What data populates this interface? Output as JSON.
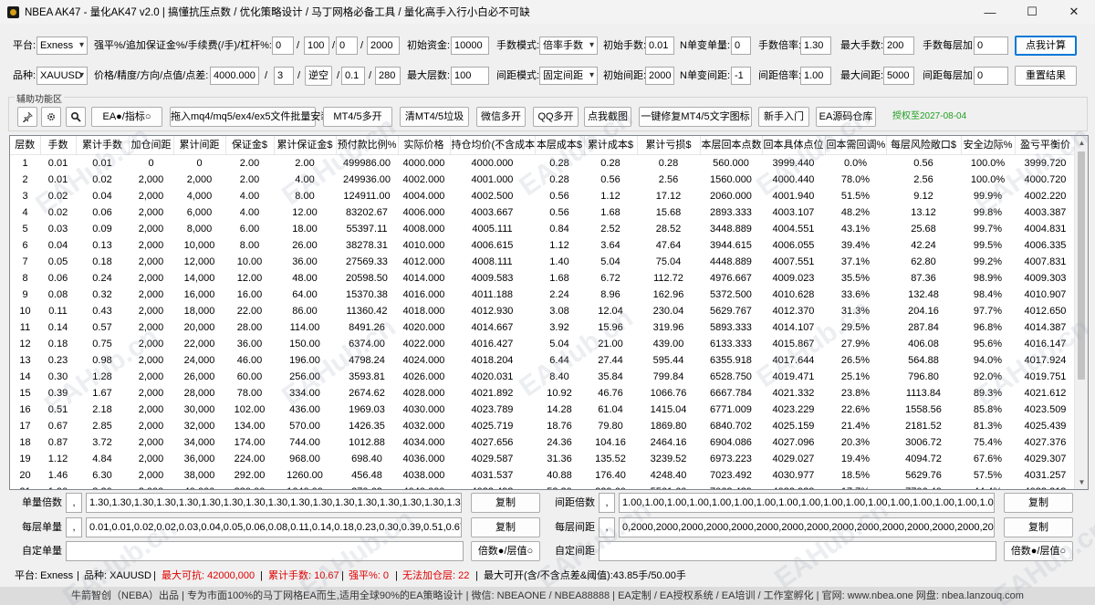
{
  "window": {
    "title": "NBEA AK47 - 量化AK47 v2.0 | 搞懂抗压点数 / 优化策略设计 / 马丁网格必备工具 / 量化高手入行小白必不可缺",
    "minimize": "—",
    "maximize": "☐",
    "close": "✕"
  },
  "row1": {
    "platform_label": "平台:",
    "platform_value": "Exness",
    "params_label": "强平%/追加保证金%/手续费(/手)/杠杆%:",
    "p1": "0",
    "p2": "100",
    "p3": "0",
    "p4": "2000",
    "initial_capital_label": "初始资金:",
    "initial_capital": "10000",
    "lot_mode_label": "手数模式:",
    "lot_mode": "倍率手数",
    "initial_lot_label": "初始手数:",
    "initial_lot": "0.01",
    "n_lot_label": "N单变单量:",
    "n_lot": "0",
    "lot_mult_label": "手数倍率:",
    "lot_mult": "1.30",
    "max_lot_label": "最大手数:",
    "max_lot": "200",
    "lot_add_label": "手数每层加:",
    "lot_add": "0",
    "calc_button": "点我计算"
  },
  "row2": {
    "symbol_label": "品种:",
    "symbol_value": "XAUUSD",
    "price_label": "价格/精度/方向/点值/点差:",
    "price": "4000.000",
    "precision": "3",
    "direction": "逆空",
    "point_value": "0.1",
    "spread": "280",
    "max_layers_label": "最大层数:",
    "max_layers": "100",
    "spacing_mode_label": "间距模式:",
    "spacing_mode": "固定间距",
    "initial_spacing_label": "初始间距:",
    "initial_spacing": "2000",
    "n_spacing_label": "N单变间距:",
    "n_spacing": "-1",
    "spacing_mult_label": "间距倍率:",
    "spacing_mult": "1.00",
    "max_spacing_label": "最大间距:",
    "max_spacing": "5000",
    "spacing_add_label": "间距每层加:",
    "spacing_add": "0",
    "reset_button": "重置结果"
  },
  "tools": {
    "group_label": "辅助功能区",
    "ea_indicator": "EA●/指标○",
    "drag_install": "拖入mq4/mq5/ex4/ex5文件批量安装",
    "mt4_multi": "MT4/5多开",
    "clean_junk": "清MT4/5垃圾",
    "wechat_multi": "微信多开",
    "qq_multi": "QQ多开",
    "screenshot": "点我截图",
    "fix_text": "一键修复MT4/5文字图标",
    "beginner": "新手入门",
    "ea_repo": "EA源码仓库",
    "auth_until": "授权至2027-08-04"
  },
  "table": {
    "headers": [
      "层数",
      "手数",
      "累计手数",
      "加仓间距",
      "累计间距",
      "保证金$",
      "累计保证金$",
      "预付款比例%",
      "实际价格",
      "持仓均价(不含成本)",
      "本层成本$",
      "累计成本$",
      "累计亏损$",
      "本层回本点数",
      "回本具体点位",
      "回本需回调%",
      "每层风险敞口$",
      "安全边际%",
      "盈亏平衡价"
    ],
    "rows": [
      [
        "1",
        "0.01",
        "0.01",
        "0",
        "0",
        "2.00",
        "2.00",
        "499986.00",
        "4000.000",
        "4000.000",
        "0.28",
        "0.28",
        "0.28",
        "560.000",
        "3999.440",
        "0.0%",
        "0.56",
        "100.0%",
        "3999.720"
      ],
      [
        "2",
        "0.01",
        "0.02",
        "2,000",
        "2,000",
        "2.00",
        "4.00",
        "249936.00",
        "4002.000",
        "4001.000",
        "0.28",
        "0.56",
        "2.56",
        "1560.000",
        "4000.440",
        "78.0%",
        "2.56",
        "100.0%",
        "4000.720"
      ],
      [
        "3",
        "0.02",
        "0.04",
        "2,000",
        "4,000",
        "4.00",
        "8.00",
        "124911.00",
        "4004.000",
        "4002.500",
        "0.56",
        "1.12",
        "17.12",
        "2060.000",
        "4001.940",
        "51.5%",
        "9.12",
        "99.9%",
        "4002.220"
      ],
      [
        "4",
        "0.02",
        "0.06",
        "2,000",
        "6,000",
        "4.00",
        "12.00",
        "83202.67",
        "4006.000",
        "4003.667",
        "0.56",
        "1.68",
        "15.68",
        "2893.333",
        "4003.107",
        "48.2%",
        "13.12",
        "99.8%",
        "4003.387"
      ],
      [
        "5",
        "0.03",
        "0.09",
        "2,000",
        "8,000",
        "6.00",
        "18.00",
        "55397.11",
        "4008.000",
        "4005.111",
        "0.84",
        "2.52",
        "28.52",
        "3448.889",
        "4004.551",
        "43.1%",
        "25.68",
        "99.7%",
        "4004.831"
      ],
      [
        "6",
        "0.04",
        "0.13",
        "2,000",
        "10,000",
        "8.00",
        "26.00",
        "38278.31",
        "4010.000",
        "4006.615",
        "1.12",
        "3.64",
        "47.64",
        "3944.615",
        "4006.055",
        "39.4%",
        "42.24",
        "99.5%",
        "4006.335"
      ],
      [
        "7",
        "0.05",
        "0.18",
        "2,000",
        "12,000",
        "10.00",
        "36.00",
        "27569.33",
        "4012.000",
        "4008.111",
        "1.40",
        "5.04",
        "75.04",
        "4448.889",
        "4007.551",
        "37.1%",
        "62.80",
        "99.2%",
        "4007.831"
      ],
      [
        "8",
        "0.06",
        "0.24",
        "2,000",
        "14,000",
        "12.00",
        "48.00",
        "20598.50",
        "4014.000",
        "4009.583",
        "1.68",
        "6.72",
        "112.72",
        "4976.667",
        "4009.023",
        "35.5%",
        "87.36",
        "98.9%",
        "4009.303"
      ],
      [
        "9",
        "0.08",
        "0.32",
        "2,000",
        "16,000",
        "16.00",
        "64.00",
        "15370.38",
        "4016.000",
        "4011.188",
        "2.24",
        "8.96",
        "162.96",
        "5372.500",
        "4010.628",
        "33.6%",
        "132.48",
        "98.4%",
        "4010.907"
      ],
      [
        "10",
        "0.11",
        "0.43",
        "2,000",
        "18,000",
        "22.00",
        "86.00",
        "11360.42",
        "4018.000",
        "4012.930",
        "3.08",
        "12.04",
        "230.04",
        "5629.767",
        "4012.370",
        "31.3%",
        "204.16",
        "97.7%",
        "4012.650"
      ],
      [
        "11",
        "0.14",
        "0.57",
        "2,000",
        "20,000",
        "28.00",
        "114.00",
        "8491.26",
        "4020.000",
        "4014.667",
        "3.92",
        "15.96",
        "319.96",
        "5893.333",
        "4014.107",
        "29.5%",
        "287.84",
        "96.8%",
        "4014.387"
      ],
      [
        "12",
        "0.18",
        "0.75",
        "2,000",
        "22,000",
        "36.00",
        "150.00",
        "6374.00",
        "4022.000",
        "4016.427",
        "5.04",
        "21.00",
        "439.00",
        "6133.333",
        "4015.867",
        "27.9%",
        "406.08",
        "95.6%",
        "4016.147"
      ],
      [
        "13",
        "0.23",
        "0.98",
        "2,000",
        "24,000",
        "46.00",
        "196.00",
        "4798.24",
        "4024.000",
        "4018.204",
        "6.44",
        "27.44",
        "595.44",
        "6355.918",
        "4017.644",
        "26.5%",
        "564.88",
        "94.0%",
        "4017.924"
      ],
      [
        "14",
        "0.30",
        "1.28",
        "2,000",
        "26,000",
        "60.00",
        "256.00",
        "3593.81",
        "4026.000",
        "4020.031",
        "8.40",
        "35.84",
        "799.84",
        "6528.750",
        "4019.471",
        "25.1%",
        "796.80",
        "92.0%",
        "4019.751"
      ],
      [
        "15",
        "0.39",
        "1.67",
        "2,000",
        "28,000",
        "78.00",
        "334.00",
        "2674.62",
        "4028.000",
        "4021.892",
        "10.92",
        "46.76",
        "1066.76",
        "6667.784",
        "4021.332",
        "23.8%",
        "1113.84",
        "89.3%",
        "4021.612"
      ],
      [
        "16",
        "0.51",
        "2.18",
        "2,000",
        "30,000",
        "102.00",
        "436.00",
        "1969.03",
        "4030.000",
        "4023.789",
        "14.28",
        "61.04",
        "1415.04",
        "6771.009",
        "4023.229",
        "22.6%",
        "1558.56",
        "85.8%",
        "4023.509"
      ],
      [
        "17",
        "0.67",
        "2.85",
        "2,000",
        "32,000",
        "134.00",
        "570.00",
        "1426.35",
        "4032.000",
        "4025.719",
        "18.76",
        "79.80",
        "1869.80",
        "6840.702",
        "4025.159",
        "21.4%",
        "2181.52",
        "81.3%",
        "4025.439"
      ],
      [
        "18",
        "0.87",
        "3.72",
        "2,000",
        "34,000",
        "174.00",
        "744.00",
        "1012.88",
        "4034.000",
        "4027.656",
        "24.36",
        "104.16",
        "2464.16",
        "6904.086",
        "4027.096",
        "20.3%",
        "3006.72",
        "75.4%",
        "4027.376"
      ],
      [
        "19",
        "1.12",
        "4.84",
        "2,000",
        "36,000",
        "224.00",
        "968.00",
        "698.40",
        "4036.000",
        "4029.587",
        "31.36",
        "135.52",
        "3239.52",
        "6973.223",
        "4029.027",
        "19.4%",
        "4094.72",
        "67.6%",
        "4029.307"
      ],
      [
        "20",
        "1.46",
        "6.30",
        "2,000",
        "38,000",
        "292.00",
        "1260.00",
        "456.48",
        "4038.000",
        "4031.537",
        "40.88",
        "176.40",
        "4248.40",
        "7023.492",
        "4030.977",
        "18.5%",
        "5629.76",
        "57.5%",
        "4031.257"
      ],
      [
        "21",
        "1.90",
        "8.20",
        "2,000",
        "40,000",
        "380.00",
        "1640.00",
        "270.63",
        "4040.000",
        "4033.498",
        "53.20",
        "229.60",
        "5561.60",
        "7062.439",
        "4032.938",
        "17.7%",
        "7706.40",
        "44.4%",
        "4033.218"
      ],
      [
        "22",
        "2.47",
        "10.67",
        "2,000",
        "42,000",
        "494.00",
        "2134.00",
        "127.89",
        "4042.000",
        "4035.466",
        "69.16",
        "298.76",
        "7270.76",
        "7094.208",
        "4034.906",
        "16.9%",
        "10512.32",
        "27.3%",
        "4035.186"
      ]
    ]
  },
  "bottom": {
    "lot_mult_label": "单量倍数",
    "lot_mult_sep": ",",
    "lot_mult_seq": "1.30,1.30,1.30,1.30,1.30,1.30,1.30,1.30,1.30,1.30,1.30,1.30,1.30,1.30,1.30,1.30,1.30",
    "copy1": "复制",
    "spacing_mult_label": "间距倍数",
    "spacing_mult_sep": ",",
    "spacing_mult_seq": "1.00,1.00,1.00,1.00,1.00,1.00,1.00,1.00,1.00,1.00,1.00,1.00,1.00,1.00,1.00,1.00,1.00,1.00,1.00",
    "copy2": "复制",
    "layer_lot_label": "每层单量",
    "layer_lot_sep": ",",
    "layer_lot_seq": "0.01,0.01,0.02,0.02,0.03,0.04,0.05,0.06,0.08,0.11,0.14,0.18,0.23,0.30,0.39,0.51,0.67,0",
    "copy3": "复制",
    "layer_spacing_label": "每层间距",
    "layer_spacing_sep": ",",
    "layer_spacing_seq": "0,2000,2000,2000,2000,2000,2000,2000,2000,2000,2000,2000,2000,2000,2000,2000,2000,20",
    "copy4": "复制",
    "custom_lot_label": "自定单量",
    "custom_lot_value": "",
    "mult_layer1": "倍数●/层值○",
    "custom_spacing_label": "自定间距",
    "custom_spacing_value": "",
    "mult_layer2": "倍数●/层值○"
  },
  "status": {
    "platform": "平台: Exness",
    "symbol": "品种: XAUUSD",
    "max_resist": "最大可抗: 42000,000",
    "cum_lot": "累计手数: 10.67",
    "liq": "强平%: 0",
    "no_add": "无法加仓层: 22",
    "max_open": "最大可开(含/不含点差&阈值):43.85手/50.00手"
  },
  "footer": {
    "text": "牛箭智创（NEBA）出品 | 专为市面100%的马丁网格EA而生,适用全球90%的EA策略设计 | 微信: NBEAONE / NBEA88888 | EA定制 / EA授权系统 / EA培训 / 工作室孵化 | 官网: www.nbea.one  网盘: nbea.lanzouq.com"
  },
  "watermark": "EAHub.cn",
  "colors": {
    "accent": "#0078d7",
    "red": "#e00000",
    "auth_green": "#22a022"
  }
}
